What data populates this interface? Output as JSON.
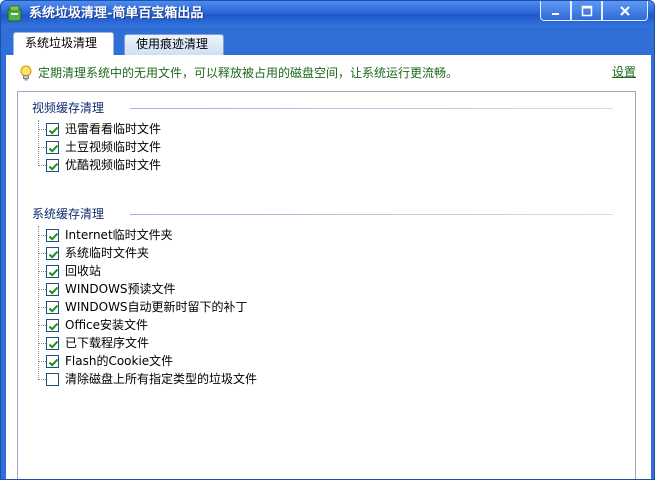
{
  "window": {
    "title": "系统垃圾清理-简单百宝箱出品",
    "accent": "#2f6fd6"
  },
  "tabs": [
    {
      "label": "系统垃圾清理",
      "active": true
    },
    {
      "label": "使用痕迹清理",
      "active": false
    }
  ],
  "hint": {
    "icon": "lightbulb-icon",
    "text": "定期清理系统中的无用文件，可以释放被占用的磁盘空间，让系统运行更流畅。",
    "settings_link": "设置"
  },
  "groups": [
    {
      "title": "视频缓存清理",
      "items": [
        {
          "label": "迅雷看看临时文件",
          "checked": true
        },
        {
          "label": "土豆视频临时文件",
          "checked": true
        },
        {
          "label": "优酷视频临时文件",
          "checked": true
        }
      ]
    },
    {
      "title": "系统缓存清理",
      "items": [
        {
          "label": "Internet临时文件夹",
          "checked": true
        },
        {
          "label": "系统临时文件夹",
          "checked": true
        },
        {
          "label": "回收站",
          "checked": true
        },
        {
          "label": "WINDOWS预读文件",
          "checked": true
        },
        {
          "label": "WINDOWS自动更新时留下的补丁",
          "checked": true
        },
        {
          "label": "Office安装文件",
          "checked": true
        },
        {
          "label": "已下载程序文件",
          "checked": true
        },
        {
          "label": "Flash的Cookie文件",
          "checked": true
        },
        {
          "label": "清除磁盘上所有指定类型的垃圾文件",
          "checked": false
        }
      ]
    }
  ]
}
